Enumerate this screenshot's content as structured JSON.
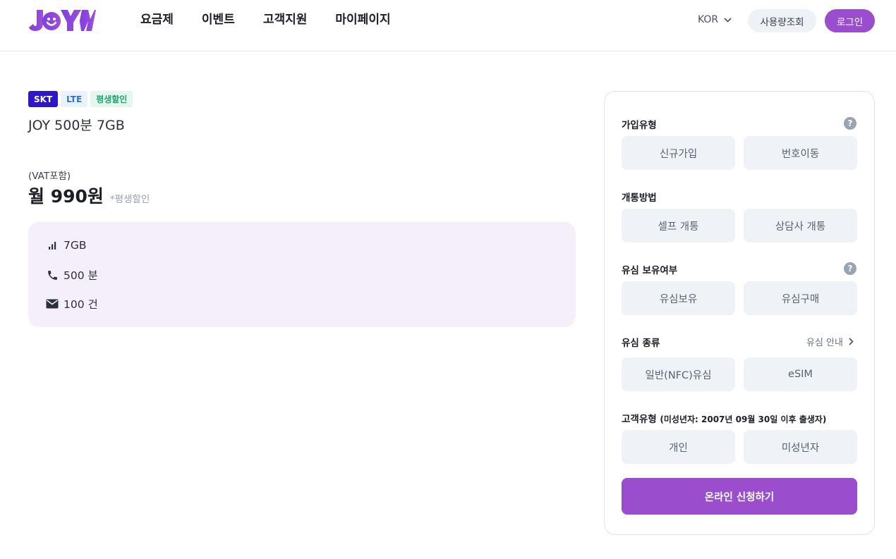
{
  "header": {
    "logo_text": "JOYM",
    "nav": [
      "요금제",
      "이벤트",
      "고객지원",
      "마이페이지"
    ],
    "language": "KOR",
    "usage_label": "사용량조회",
    "login_label": "로그인"
  },
  "plan": {
    "badges": [
      "SKT",
      "LTE",
      "평생할인"
    ],
    "name": "JOY 500분 7GB",
    "vat_label": "(VAT포함)",
    "price": "월 990원",
    "price_note": "*평생할인",
    "features": [
      {
        "icon": "signal-icon",
        "text": "7GB"
      },
      {
        "icon": "phone-icon",
        "text": "500 분"
      },
      {
        "icon": "mail-icon",
        "text": "100 건"
      }
    ]
  },
  "panel": {
    "join_type": {
      "title": "가입유형",
      "options": [
        "신규가입",
        "번호이동"
      ]
    },
    "activation": {
      "title": "개통방법",
      "options": [
        "셀프 개통",
        "상담사 개통"
      ]
    },
    "usim_own": {
      "title": "유심 보유여부",
      "options": [
        "유심보유",
        "유심구매"
      ]
    },
    "usim_type": {
      "title": "유심 종류",
      "guide": "유심 안내",
      "options": [
        "일반(NFC)유심",
        "eSIM"
      ]
    },
    "customer_type": {
      "title": "고객유형",
      "subtitle": "(미성년자: 2007년 09월 30일 이후 출생자)",
      "options": [
        "개인",
        "미성년자"
      ]
    },
    "help_icon_text": "?",
    "apply_label": "온라인 신청하기"
  },
  "colors": {
    "brand": "#9a4dcc",
    "skt_badge": "#2c17c9",
    "feature_bg": "#f5effb"
  }
}
